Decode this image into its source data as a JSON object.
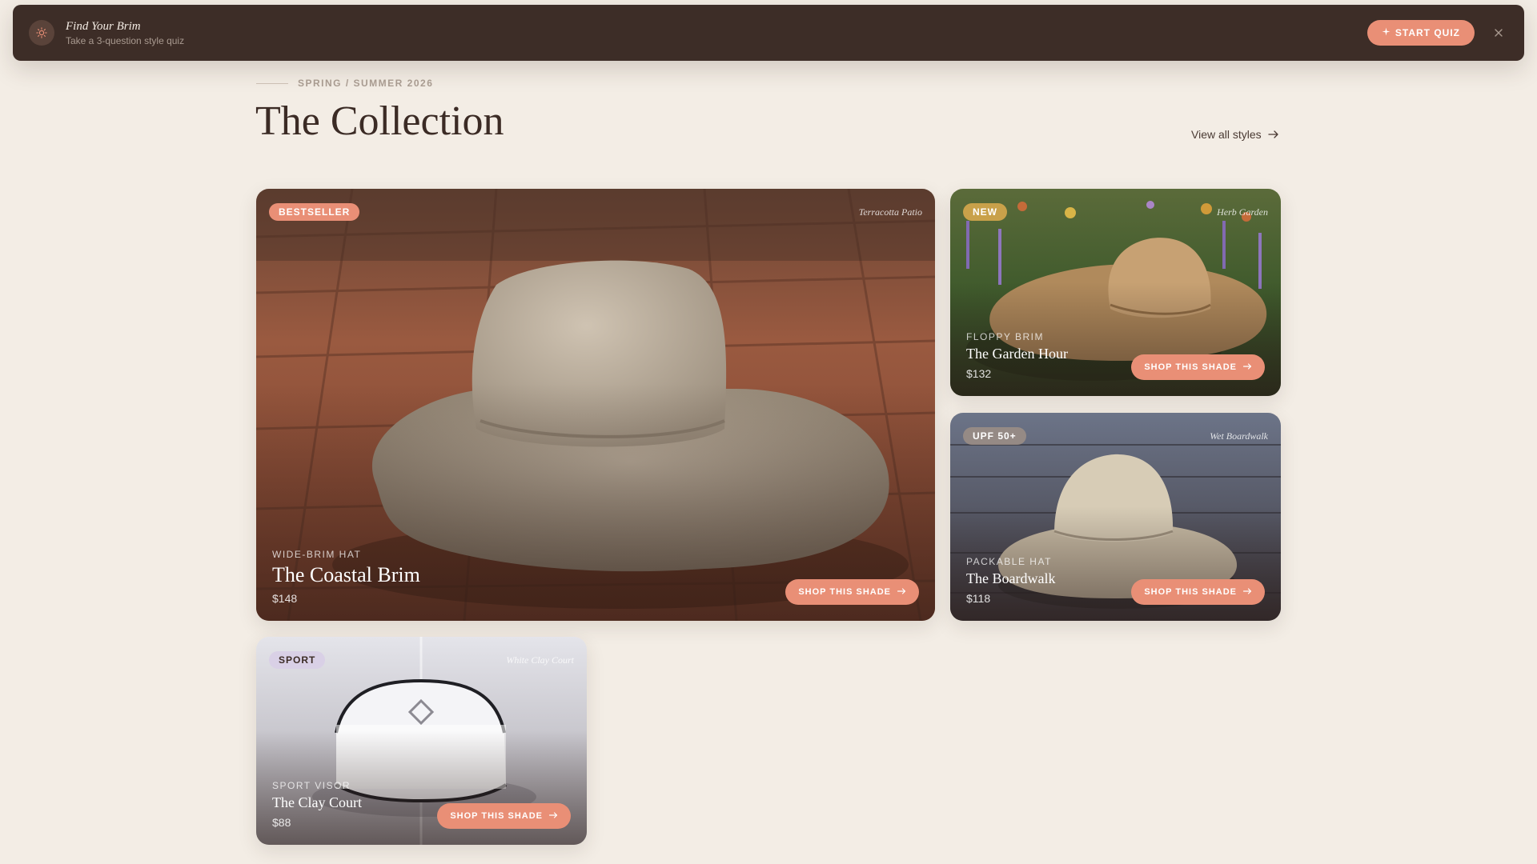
{
  "banner": {
    "title": "Find Your Brim",
    "subtitle": "Take a 3-question style quiz",
    "cta_label": "START QUIZ",
    "icon": "sun-icon",
    "close_icon": "close-icon"
  },
  "header": {
    "eyebrow": "SPRING / SUMMER 2026",
    "title": "The Collection",
    "view_all_label": "View all styles"
  },
  "colors": {
    "accent": "#e98f76",
    "dark": "#3d2d27",
    "background": "#f3ede5"
  },
  "products": [
    {
      "badge": "BESTSELLER",
      "badge_color": "#e98f76",
      "location": "Terracotta Patio",
      "category": "WIDE-BRIM HAT",
      "name": "The Coastal Brim",
      "price": "$148",
      "cta": "SHOP THIS SHADE"
    },
    {
      "badge": "NEW",
      "badge_color": "#c9a14a",
      "location": "Herb Garden",
      "category": "FLOPPY BRIM",
      "name": "The Garden Hour",
      "price": "$132",
      "cta": "SHOP THIS SHADE"
    },
    {
      "badge": "UPF 50+",
      "badge_color": "#9d8f86",
      "location": "Wet Boardwalk",
      "category": "PACKABLE HAT",
      "name": "The Boardwalk",
      "price": "$118",
      "cta": "SHOP THIS SHADE"
    },
    {
      "badge": "SPORT",
      "badge_color": "#d9d0e6",
      "location": "White Clay Court",
      "category": "SPORT VISOR",
      "name": "The Clay Court",
      "price": "$88",
      "cta": "SHOP THIS SHADE"
    }
  ]
}
